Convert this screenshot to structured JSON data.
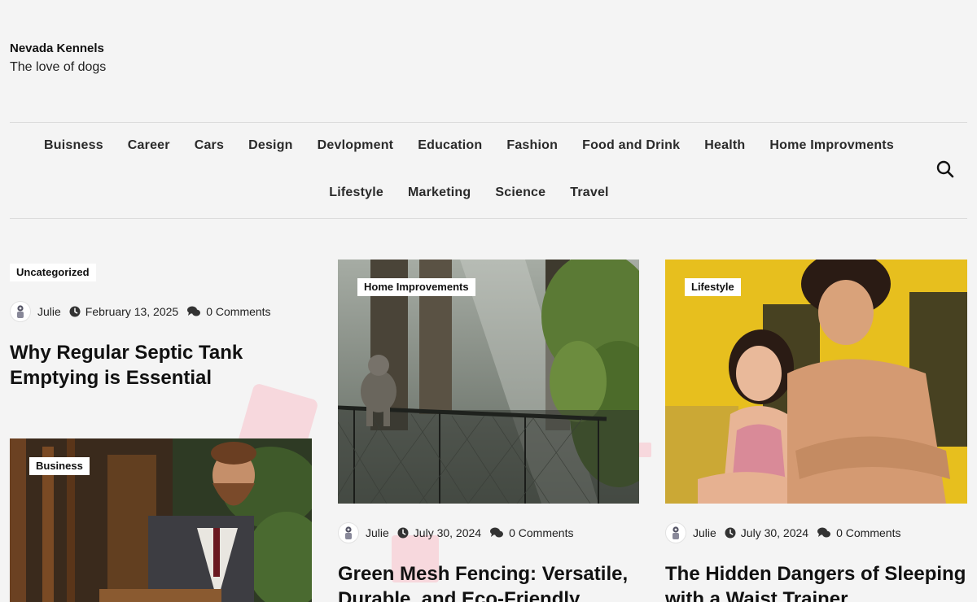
{
  "site": {
    "title": "Nevada Kennels",
    "tagline": "The love of dogs"
  },
  "nav": {
    "row1": [
      "Buisness",
      "Career",
      "Cars",
      "Design",
      "Devlopment",
      "Education",
      "Fashion",
      "Food and Drink",
      "Health",
      "Home Improvments"
    ],
    "row2": [
      "Lifestyle",
      "Marketing",
      "Science",
      "Travel"
    ],
    "search_icon": "search-icon"
  },
  "posts": [
    {
      "category": "Uncategorized",
      "author": "Julie",
      "date": "February 13, 2025",
      "comments": "0 Comments",
      "title": "Why Regular Septic Tank Emptying is Essential"
    },
    {
      "category": "Home Improvements",
      "author": "Julie",
      "date": "July 30, 2024",
      "comments": "0 Comments",
      "title": "Green Mesh Fencing: Versatile, Durable, and Eco-Friendly"
    },
    {
      "category": "Lifestyle",
      "author": "Julie",
      "date": "July 30, 2024",
      "comments": "0 Comments",
      "title": "The Hidden Dangers of Sleeping with a Waist Trainer"
    },
    {
      "category": "Business"
    }
  ],
  "colors": {
    "background": "#f4f4f4",
    "badge_bg": "#ffffff",
    "decor_pink": "#f7d2d8"
  }
}
